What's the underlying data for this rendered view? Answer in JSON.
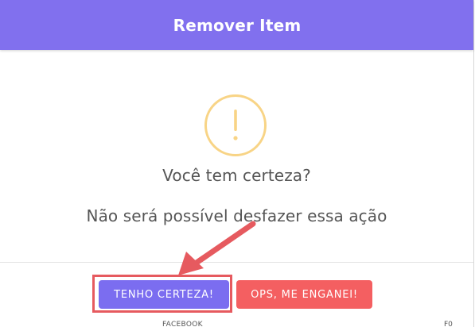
{
  "modal": {
    "title": "Remover Item",
    "icon": "exclamation-circle-icon",
    "question": "Você tem certeza?",
    "message": "Não será possível desfazer essa ação"
  },
  "buttons": {
    "confirm_label": "TENHO CERTEZA!",
    "cancel_label": "OPS, ME ENGANEI!"
  },
  "annotation": {
    "arrow_icon": "arrow-pointer-icon",
    "highlight": "confirm-button-highlight"
  },
  "background_page": {
    "footer_text": "FACEBOOK",
    "footer_code": "F0"
  },
  "colors": {
    "header": "#8170ee",
    "confirm_button": "#7b6df0",
    "cancel_button": "#f45f61",
    "warning_icon": "#f8d486",
    "annotation": "#e65a5f"
  }
}
